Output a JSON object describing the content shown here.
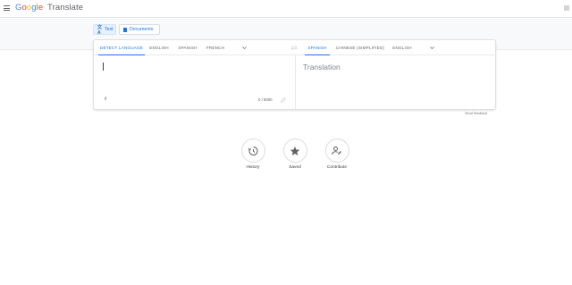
{
  "header": {
    "logo_google": [
      "G",
      "o",
      "o",
      "g",
      "l",
      "e"
    ],
    "product_name": "Translate"
  },
  "modes": {
    "text_label": "Text",
    "documents_label": "Documents"
  },
  "source_langs": [
    "DETECT LANGUAGE",
    "ENGLISH",
    "SPANISH",
    "FRENCH"
  ],
  "target_langs": [
    "SPANISH",
    "CHINESE (SIMPLIFIED)",
    "ENGLISH"
  ],
  "source": {
    "char_count": "0 / 5000",
    "value": ""
  },
  "target": {
    "placeholder": "Translation"
  },
  "send_feedback": "Send feedback",
  "actions": {
    "history": "History",
    "saved": "Saved",
    "contribute": "Contribute"
  },
  "colors": {
    "accent": "#1a73e8",
    "band": "#f8f9fa"
  },
  "icons": [
    "menu-icon",
    "apps-icon",
    "translate-text-icon",
    "document-icon",
    "chevron-down-icon",
    "swap-icon",
    "mic-icon",
    "pencil-icon",
    "history-icon",
    "star-icon",
    "contribute-icon"
  ]
}
